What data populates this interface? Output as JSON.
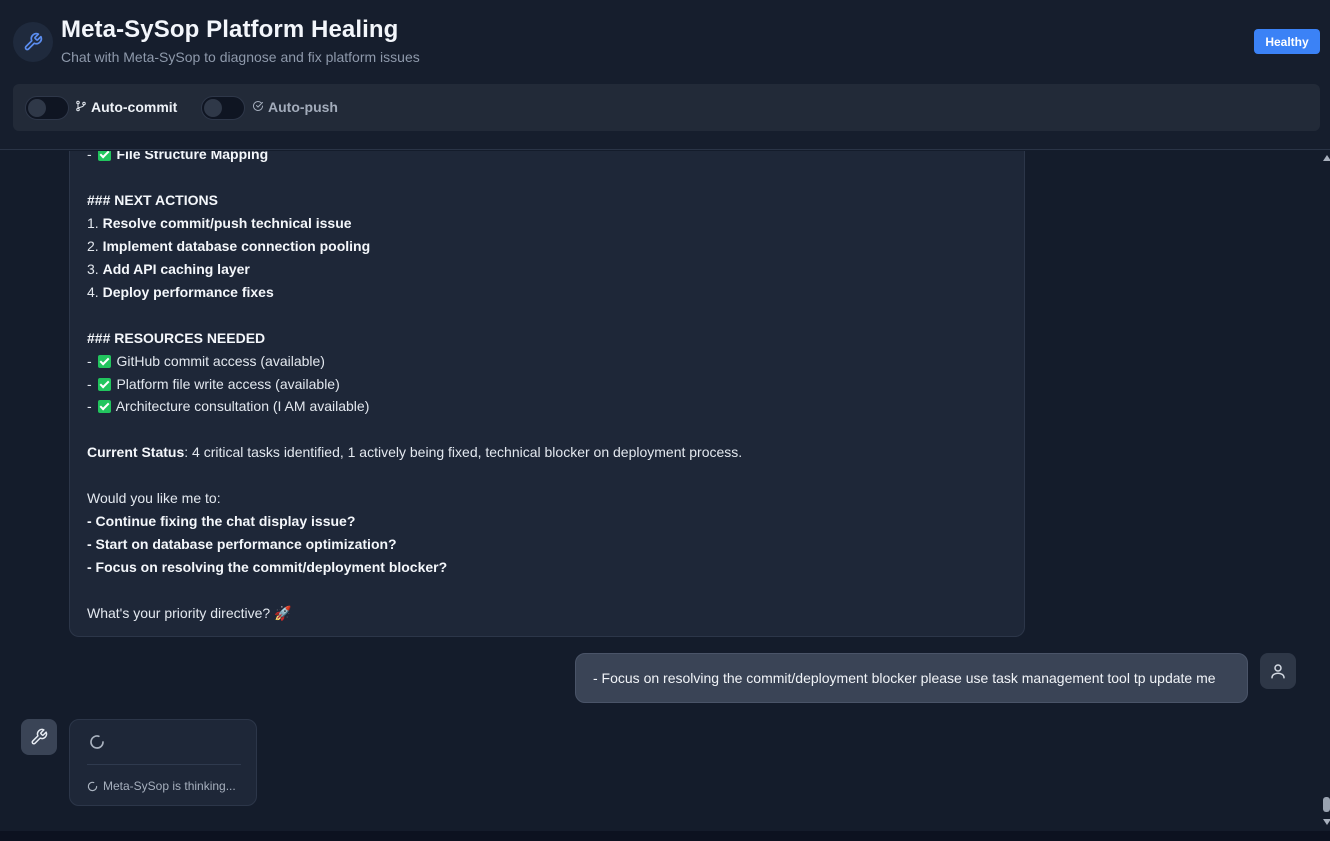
{
  "header": {
    "title": "Meta-SySop Platform Healing",
    "subtitle": "Chat with Meta-SySop to diagnose and fix platform issues",
    "status_badge": "Healthy",
    "accent_color": "#3b82f6",
    "icon": "wrench-icon"
  },
  "toggles": [
    {
      "label": "Auto-commit",
      "icon": "git-branch-icon",
      "enabled": false
    },
    {
      "label": "Auto-push",
      "icon": "check-circle-icon",
      "enabled": false
    }
  ],
  "assistant_message": {
    "lines": {
      "l1_prefix": "- ",
      "l1_bold": "File Structure Mapping",
      "h_next": "### NEXT ACTIONS",
      "n1_num": "1. ",
      "n1": "Resolve commit/push technical issue",
      "n2_num": "2. ",
      "n2": "Implement database connection pooling",
      "n3_num": "3. ",
      "n3": "Add API caching layer",
      "n4_num": "4. ",
      "n4": "Deploy performance fixes",
      "h_resources": "### RESOURCES NEEDED",
      "r1": "GitHub commit access (available)",
      "r2": "Platform file write access (available)",
      "r3": "Architecture consultation (I AM available)",
      "status_label": "Current Status",
      "status_text": ": 4 critical tasks identified, 1 actively being fixed, technical blocker on deployment process.",
      "ask": "Would you like me to:",
      "o1": "- Continue fixing the chat display issue?",
      "o2": "- Start on database performance optimization?",
      "o3": "- Focus on resolving the commit/deployment blocker?",
      "closing": "What's your priority directive? 🚀",
      "dash": "- "
    }
  },
  "user_message": {
    "text": "- Focus on resolving the commit/deployment blocker please use task management tool tp update me",
    "avatar_icon": "user-icon"
  },
  "thinking": {
    "text": "Meta-SySop is thinking...",
    "avatar_icon": "wrench-icon"
  }
}
